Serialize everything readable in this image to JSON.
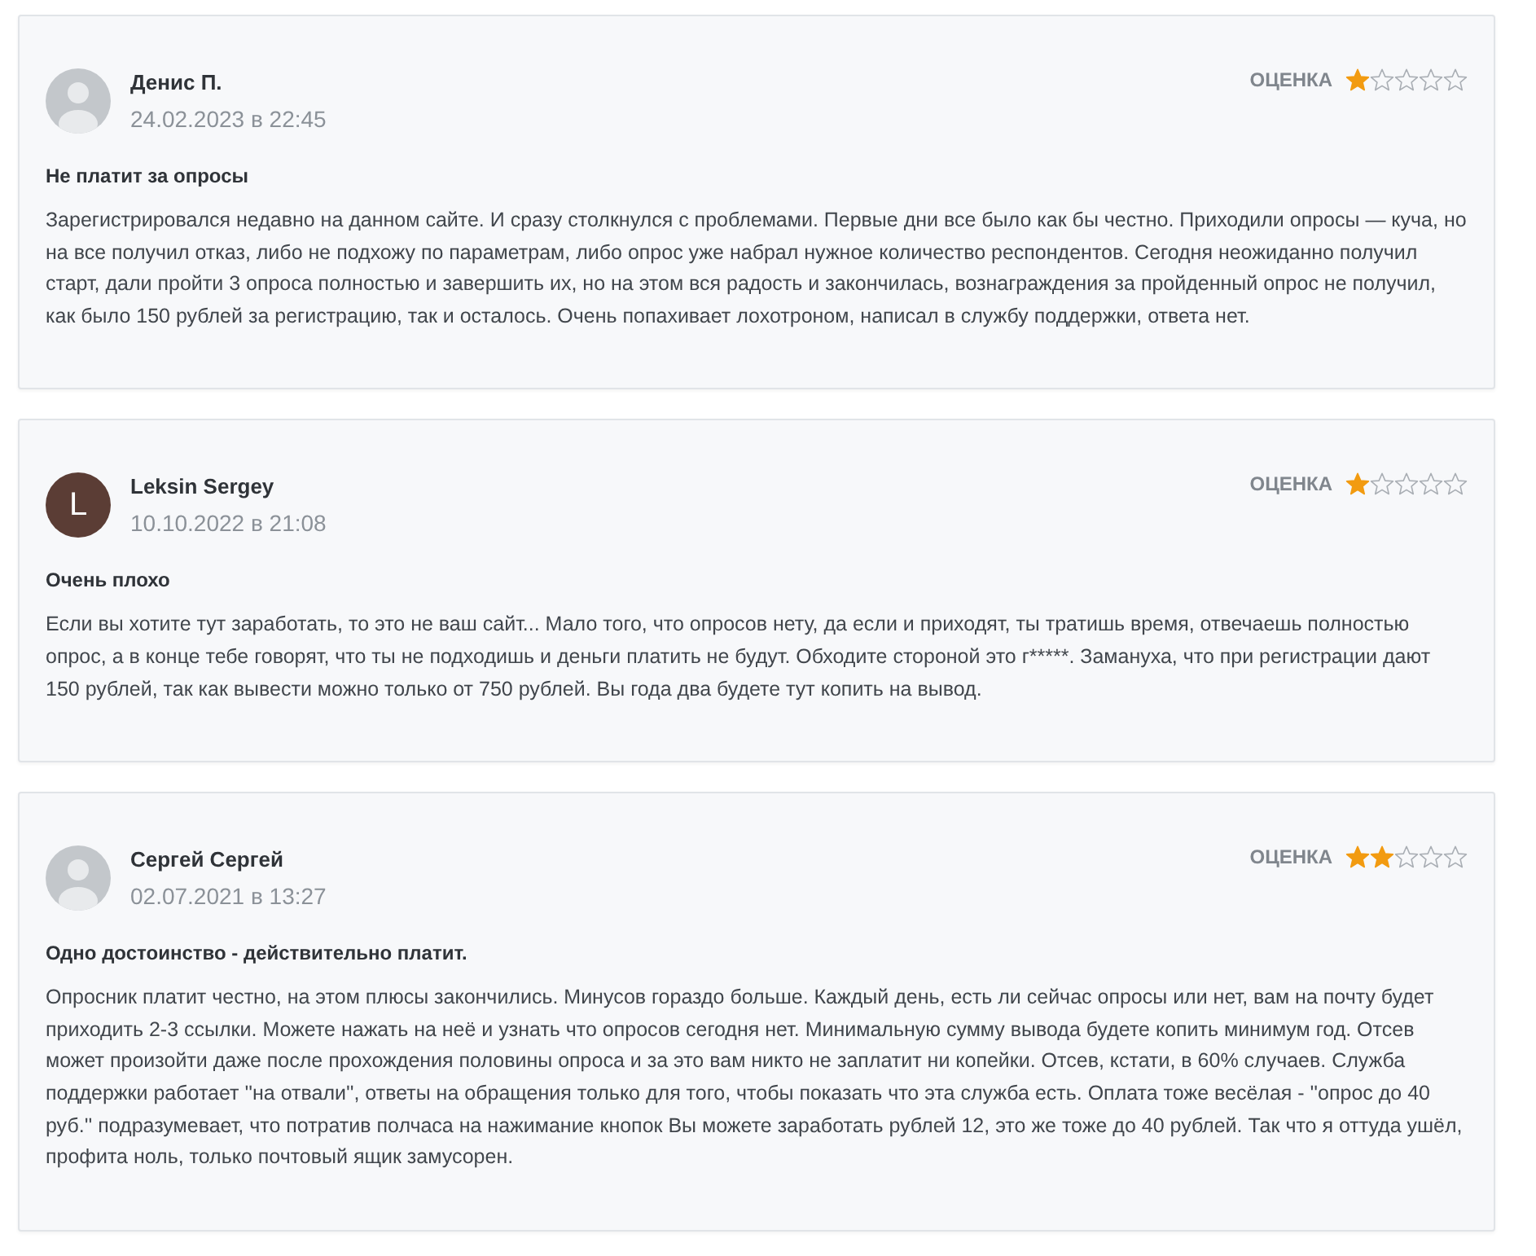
{
  "reviews": [
    {
      "author": "Денис П.",
      "date": "24.02.2023 в 22:45",
      "avatar": {
        "kind": "silhouette"
      },
      "rating_label": "ОЦЕНКА",
      "stars": 1,
      "title": "Не платит за опросы",
      "text": "Зарегистрировался недавно на данном сайте. И сразу столкнулся с проблемами. Первые дни все было как бы честно. Приходили опросы — куча, но на все получил отказ, либо не подхожу по параметрам, либо опрос уже набрал нужное количество респондентов. Сегодня неожиданно получил старт, дали пройти 3 опроса полностью и завершить их, но на этом вся радость и закончилась, вознаграждения за пройденный опрос не получил, как было 150 рублей за регистрацию, так и осталось. Очень попахивает лохотроном, написал в службу поддержки, ответа нет."
    },
    {
      "author": "Leksin Sergey",
      "date": "10.10.2022 в 21:08",
      "avatar": {
        "kind": "letter",
        "letter": "L"
      },
      "rating_label": "ОЦЕНКА",
      "stars": 1,
      "title": "Очень плохо",
      "text": "Если вы хотите тут заработать, то это не ваш сайт... Мало того, что опросов нету, да если и приходят, ты тратишь время, отвечаешь полностью опрос, а в конце тебе говорят, что ты не подходишь и деньги платить не будут. Обходите стороной это г*****. Замануха, что при регистрации дают 150 рублей, так как вывести можно только от 750 рублей. Вы года два будете тут копить на вывод."
    },
    {
      "author": "Сергей Сергей",
      "date": "02.07.2021 в 13:27",
      "avatar": {
        "kind": "silhouette"
      },
      "rating_label": "ОЦЕНКА",
      "stars": 2,
      "title": "Одно достоинство - действительно платит.",
      "text": "Опросник платит честно, на этом плюсы закончились. Минусов гораздо больше. Каждый день, есть ли сейчас опросы или нет, вам на почту будет приходить 2-3 ссылки. Можете нажать на неё и узнать что опросов сегодня нет. Минимальную сумму вывода будете копить минимум год. Отсев может произойти даже после прохождения половины опроса и за это вам никто не заплатит ни копейки. Отсев, кстати, в 60% случаев. Служба поддержки работает ''на отвали'', ответы на обращения только для того, чтобы показать что эта служба есть. Оплата тоже весёлая - ''опрос до 40 руб.'' подразумевает, что потратив полчаса на нажимание кнопок Вы можете заработать рублей 12, это же тоже до 40 рублей. Так что я оттуда ушёл, профита ноль, только почтовый ящик замусорен."
    }
  ]
}
